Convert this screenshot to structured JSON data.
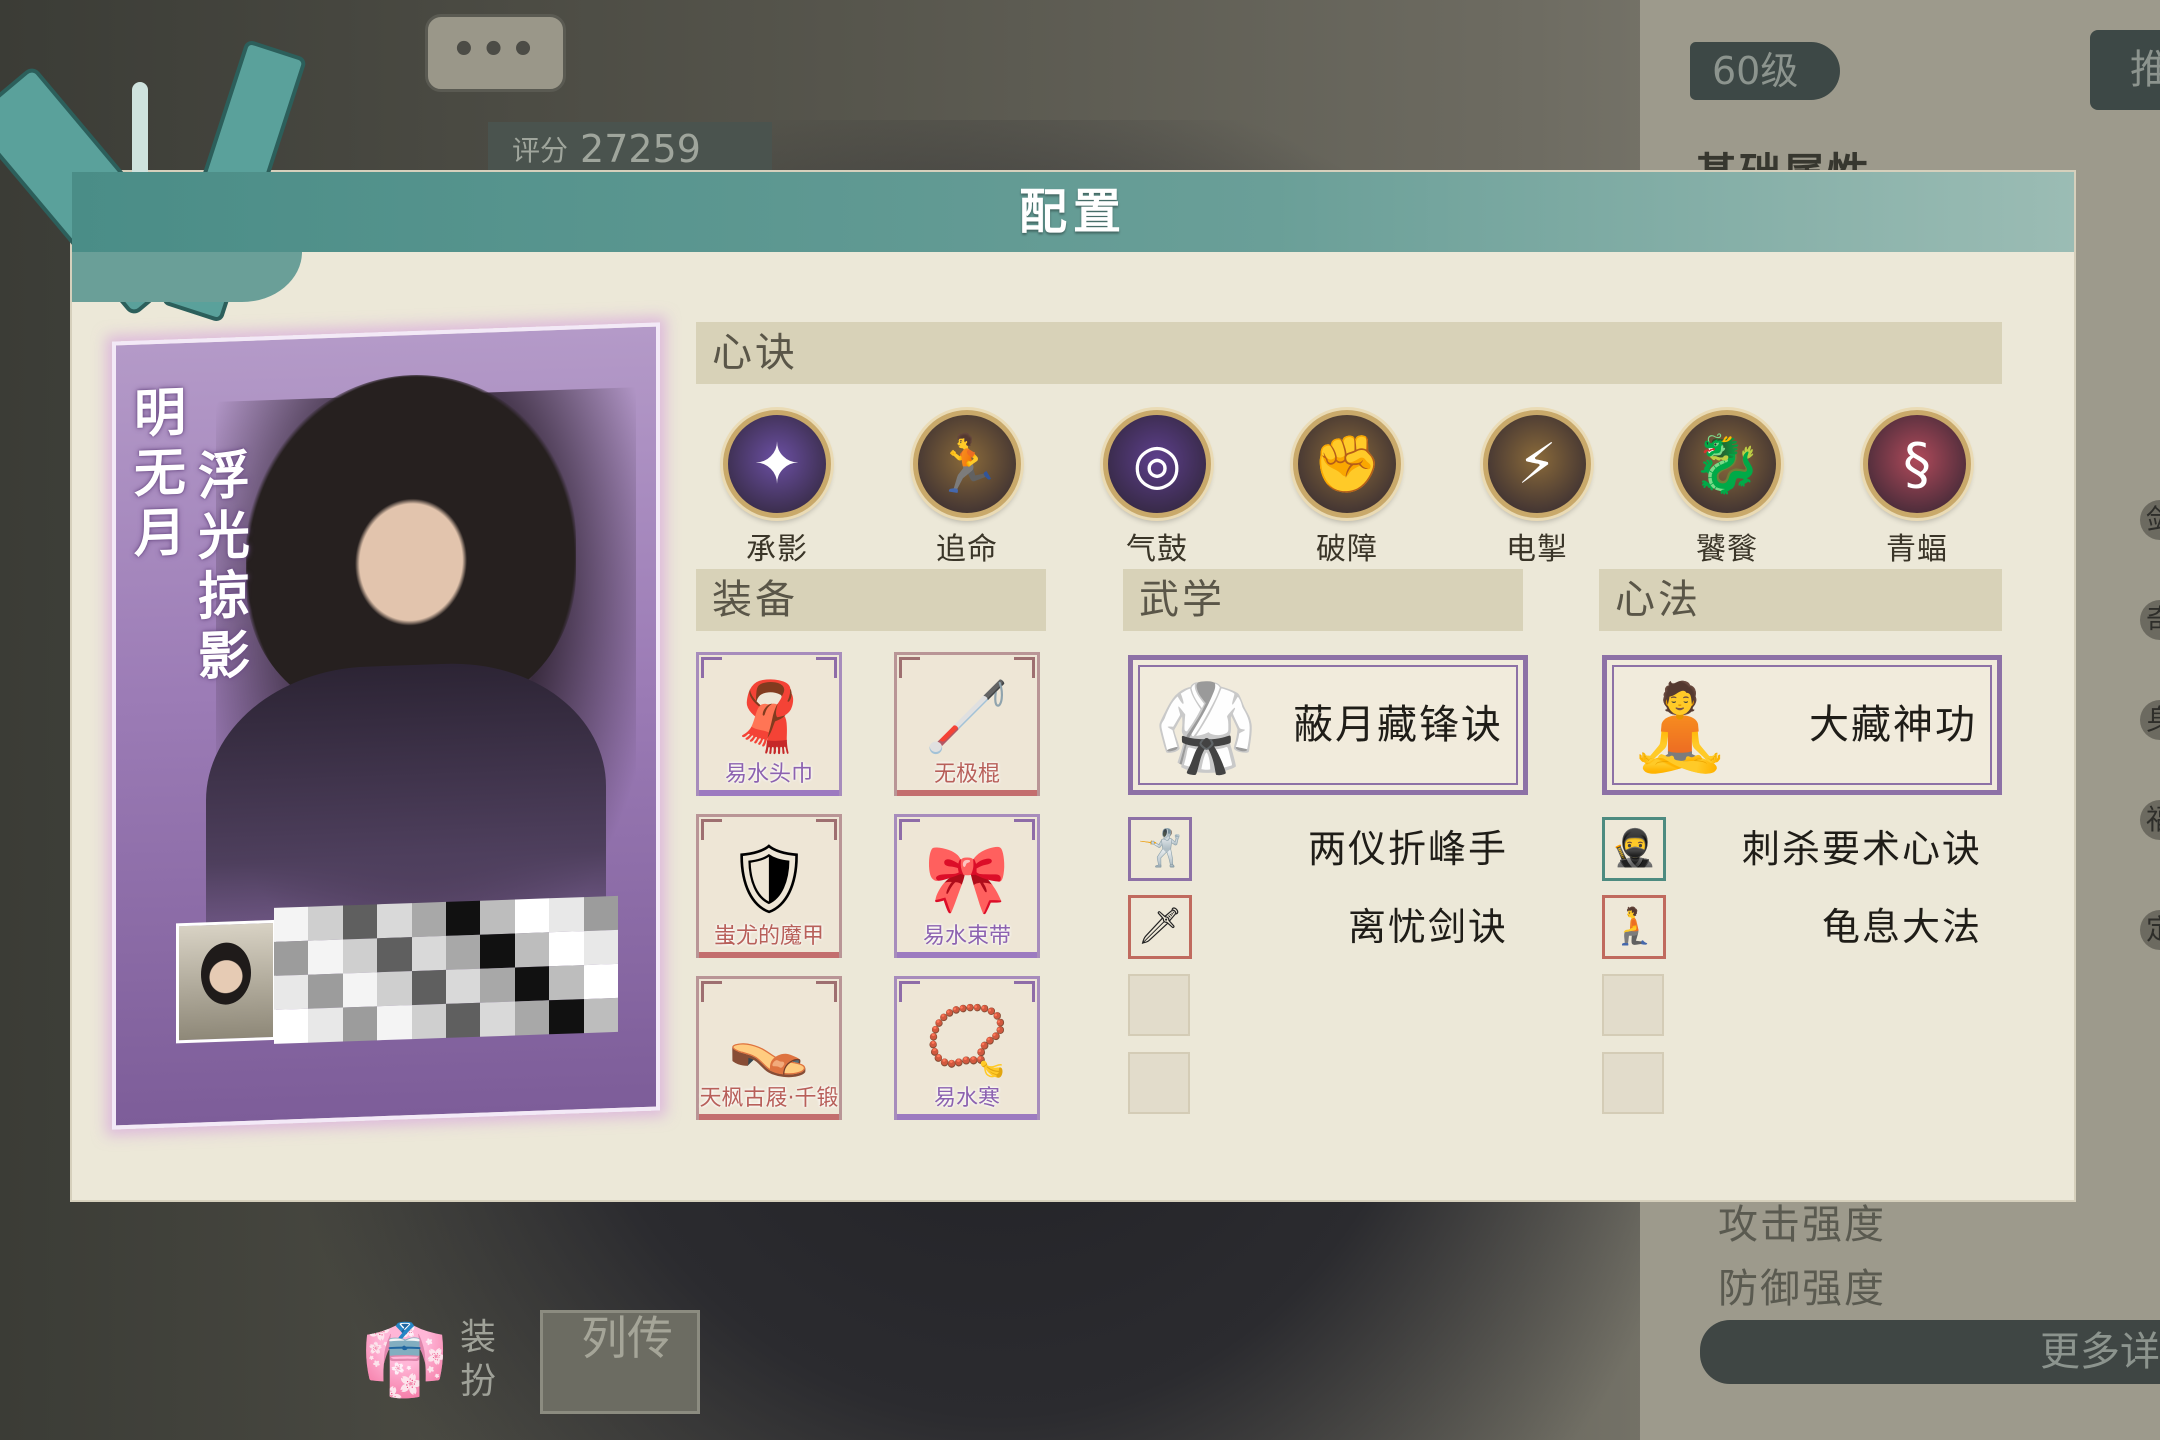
{
  "background": {
    "bubble": "•••",
    "score_label": "评分",
    "score_value": "27259",
    "level": "60级",
    "level_btn": "推",
    "basic_attr_title": "基础属性",
    "stats": [
      "攻击强度",
      "防御强度"
    ],
    "more_details": "更多详",
    "side_labels": [
      "剑",
      "奇",
      "身",
      "福",
      "定"
    ],
    "dress_label": "装扮",
    "biography_label": "列传"
  },
  "modal": {
    "title": "配置",
    "character": {
      "name": "明无月",
      "title": "浮光掠影"
    },
    "sections": {
      "xinjue": "心诀",
      "equipment": "装备",
      "martial": "武学",
      "xinfa": "心法"
    },
    "xinjue_skills": [
      {
        "name": "承影",
        "icon": "purple-light-burst-icon",
        "color": "#6b4fa3"
      },
      {
        "name": "追命",
        "icon": "golden-runner-icon",
        "color": "#8a6a3a"
      },
      {
        "name": "气鼓",
        "icon": "purple-vortex-icon",
        "color": "#5d3f8c"
      },
      {
        "name": "破障",
        "icon": "golden-fist-icon",
        "color": "#8a6a3a"
      },
      {
        "name": "电掣",
        "icon": "golden-lightning-icon",
        "color": "#8a6a3a"
      },
      {
        "name": "饕餮",
        "icon": "golden-beast-icon",
        "color": "#8a6a3a"
      },
      {
        "name": "青蝠",
        "icon": "red-swirl-icon",
        "color": "#b04a5a"
      }
    ],
    "equipment": [
      {
        "name": "易水头巾",
        "icon": "headscarf-icon",
        "rarity": "purple"
      },
      {
        "name": "无极棍",
        "icon": "staff-icon",
        "rarity": "red"
      },
      {
        "name": "蚩尤的魔甲",
        "icon": "armor-icon",
        "rarity": "red"
      },
      {
        "name": "易水束带",
        "icon": "belt-icon",
        "rarity": "purple"
      },
      {
        "name": "天枫古屐·千锻",
        "icon": "clogs-icon",
        "rarity": "red"
      },
      {
        "name": "易水寒",
        "icon": "bracelet-icon",
        "rarity": "purple"
      }
    ],
    "martial": {
      "main": "蔽月藏锋诀",
      "subs": [
        "两仪折峰手",
        "离忧剑诀"
      ]
    },
    "xinfa": {
      "main": "大藏神功",
      "subs": [
        "刺杀要术心诀",
        "龟息大法"
      ]
    }
  }
}
